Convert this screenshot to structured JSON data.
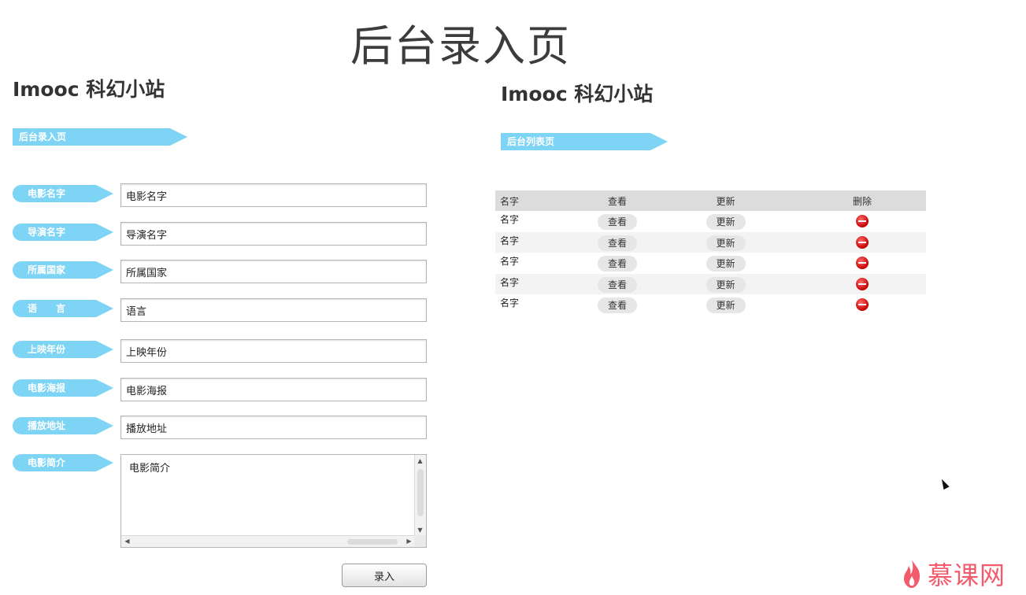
{
  "slide_title": "后台录入页",
  "left_panel": {
    "site_title": "Imooc 科幻小站",
    "banner": "后台录入页",
    "fields": [
      {
        "label": "电影名字",
        "value": "电影名字"
      },
      {
        "label": "导演名字",
        "value": "导演名字"
      },
      {
        "label": "所属国家",
        "value": "所属国家"
      },
      {
        "label": "语　　言",
        "value": "语言"
      },
      {
        "label": "上映年份",
        "value": "上映年份"
      },
      {
        "label": "电影海报",
        "value": "电影海报"
      },
      {
        "label": "播放地址",
        "value": "播放地址"
      },
      {
        "label": "电影简介",
        "value": "电影简介"
      }
    ],
    "submit_label": "录入"
  },
  "right_panel": {
    "site_title": "Imooc 科幻小站",
    "banner": "后台列表页",
    "table": {
      "headers": [
        "名字",
        "查看",
        "更新",
        "删除"
      ],
      "rows": [
        {
          "name": "名字",
          "view": "查看",
          "update": "更新"
        },
        {
          "name": "名字",
          "view": "查看",
          "update": "更新"
        },
        {
          "name": "名字",
          "view": "查看",
          "update": "更新"
        },
        {
          "name": "名字",
          "view": "查看",
          "update": "更新"
        },
        {
          "name": "名字",
          "view": "查看",
          "update": "更新"
        }
      ]
    }
  },
  "watermark": {
    "text": "慕课网",
    "color": "#f35a6a"
  },
  "colors": {
    "accent": "#7dd4f4",
    "delete": "#d40000"
  }
}
